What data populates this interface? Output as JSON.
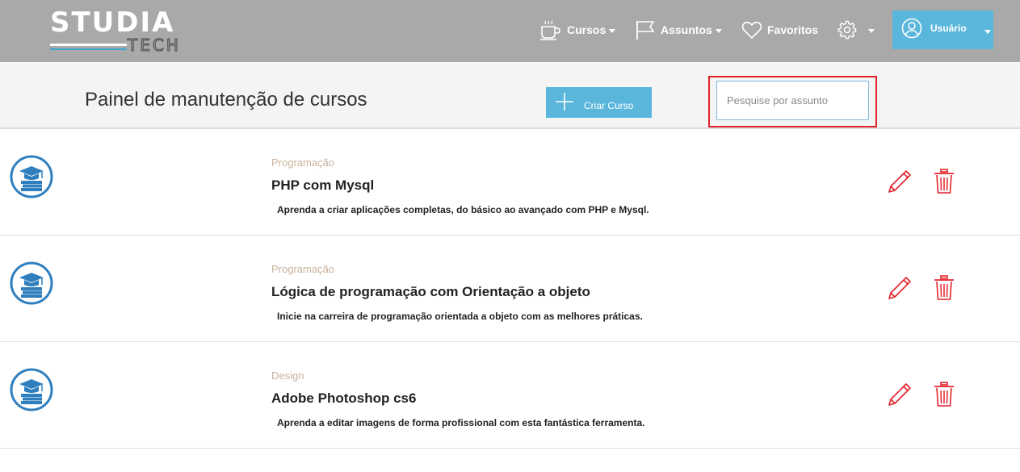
{
  "brand": {
    "logo_text_main": "STUDIA",
    "logo_text_sub": "TECH"
  },
  "navbar": {
    "items": [
      {
        "label": "Cursos",
        "icon": "coffee-cup-icon",
        "has_dropdown": true
      },
      {
        "label": "Assuntos",
        "icon": "flag-icon",
        "has_dropdown": true
      },
      {
        "label": "Favoritos",
        "icon": "heart-icon",
        "has_dropdown": false
      }
    ],
    "settings": {
      "icon": "gear-icon",
      "has_dropdown": true
    },
    "user": {
      "label": "Usuário",
      "icon": "user-avatar-icon"
    }
  },
  "toolbar": {
    "title": "Painel de manutenção de cursos",
    "create_label": "Criar Curso",
    "search_placeholder": "Pesquise por assunto",
    "search_value": ""
  },
  "courses": [
    {
      "category": "Programação",
      "name": "PHP com Mysql",
      "description": "Aprenda a criar aplicações completas, do básico ao avançado com PHP e Mysql."
    },
    {
      "category": "Programação",
      "name": "Lógica de programação com Orientação a objeto",
      "description": "Inicie na carreira de programação orientada a objeto com as melhores práticas."
    },
    {
      "category": "Design",
      "name": "Adobe Photoshop cs6",
      "description": "Aprenda a editar imagens de forma profissional com esta fantástica ferramenta."
    }
  ],
  "colors": {
    "navbar_bg": "#a9a9a9",
    "accent_blue": "#5bb6dc",
    "course_icon_blue": "#2f7fbf",
    "action_red": "#e3232b",
    "category_text": "#c9b39c",
    "highlight_outline": "#e3232b"
  }
}
